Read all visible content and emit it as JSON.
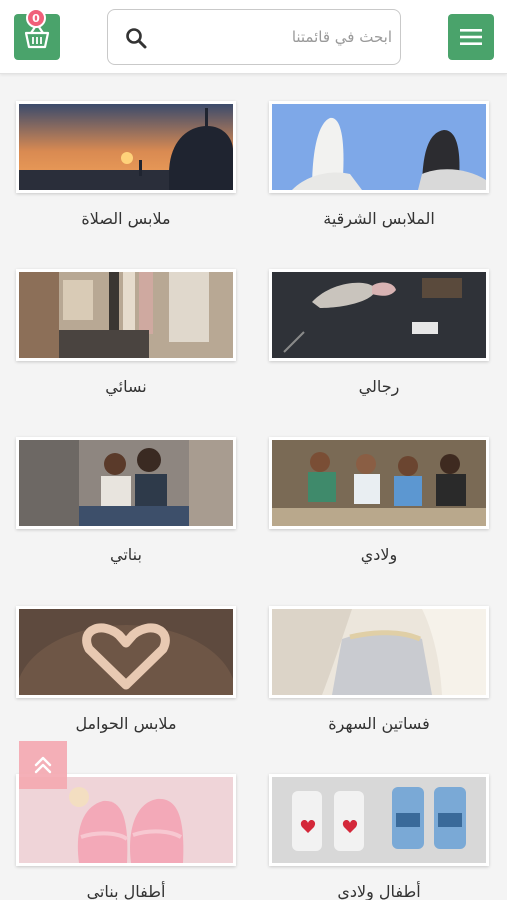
{
  "header": {
    "cart_count": "0",
    "search_placeholder": "ابحث في قائمتنا"
  },
  "categories": [
    {
      "label": "الملابس الشرقية"
    },
    {
      "label": "ملابس الصلاة"
    },
    {
      "label": "رجالي"
    },
    {
      "label": "نسائي"
    },
    {
      "label": "ولادي"
    },
    {
      "label": "بناتي"
    },
    {
      "label": "فساتين السهرة"
    },
    {
      "label": "ملابس الحوامل"
    },
    {
      "label": "أطفال ولادي"
    },
    {
      "label": "أطفال بناتي"
    }
  ],
  "colors": {
    "brand_green": "#4aa36b",
    "badge_pink": "#f0607a",
    "scroll_button": "#f5aab2"
  },
  "icons": {
    "cart": "basket-icon",
    "search": "search-icon",
    "menu": "hamburger-icon",
    "scroll_top": "double-chevron-up-icon"
  }
}
